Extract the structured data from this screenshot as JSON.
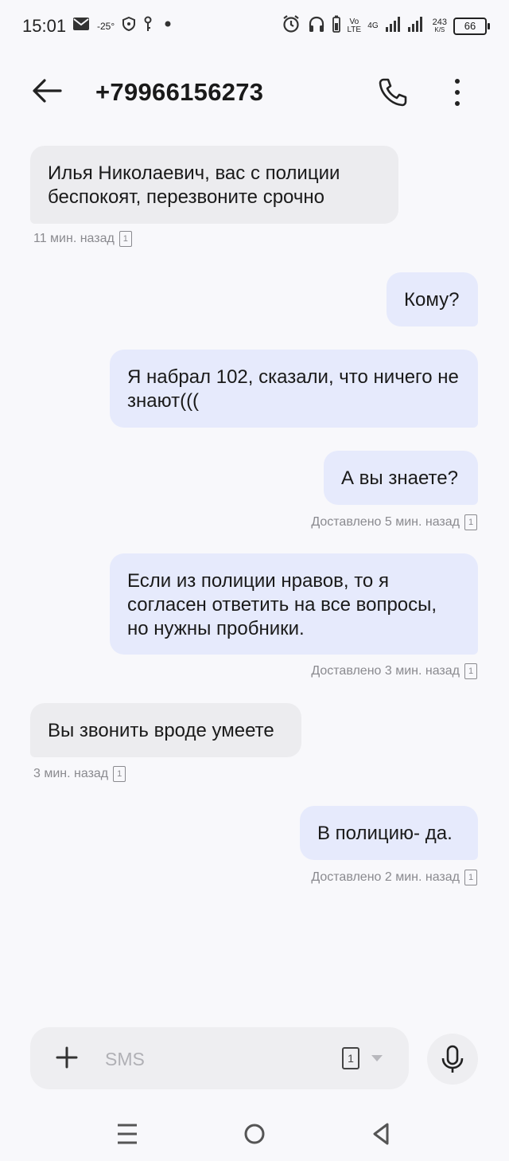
{
  "status_bar": {
    "time": "15:01",
    "temperature": "-25°",
    "volte": "Vo LTE",
    "network": "4G",
    "speed_value": "243",
    "speed_unit": "K/S",
    "battery": "66",
    "icons": [
      "mail-icon",
      "shield-icon",
      "key-icon",
      "dot-icon",
      "alarm-icon",
      "headphones-icon",
      "signal-icon",
      "signal-icon-2"
    ]
  },
  "header": {
    "title": "+79966156273",
    "icons": [
      "back-arrow-icon",
      "phone-icon",
      "more-vertical-icon"
    ]
  },
  "messages": [
    {
      "direction": "in",
      "text": "Илья Николаевич, вас с полиции беспокоят, перезвоните срочно",
      "meta": "11 мин. назад",
      "sim": "1"
    },
    {
      "direction": "out",
      "text": "Кому?",
      "meta": "",
      "sim": ""
    },
    {
      "direction": "out",
      "text": "Я набрал 102, сказали, что ничего не знают(((",
      "meta": "",
      "sim": ""
    },
    {
      "direction": "out",
      "text": "А вы знаете?",
      "meta": "Доставлено 5 мин. назад",
      "sim": "1"
    },
    {
      "direction": "out",
      "text": "Если из полиции нравов, то я согласен ответить на все вопросы, но нужны пробники.",
      "meta": "Доставлено 3 мин. назад",
      "sim": "1"
    },
    {
      "direction": "in",
      "text": "Вы звонить вроде умеете",
      "meta": "3 мин. назад",
      "sim": "1"
    },
    {
      "direction": "out",
      "text": "В полицию- да.",
      "meta": "Доставлено 2 мин. назад",
      "sim": "1"
    }
  ],
  "composer": {
    "placeholder": "SMS",
    "value": "",
    "sim": "1",
    "icons": [
      "plus-icon",
      "sim-card-icon",
      "dropdown-arrow-icon",
      "microphone-icon"
    ]
  },
  "nav": {
    "icons": [
      "menu-icon",
      "home-circle-icon",
      "back-triangle-icon"
    ]
  },
  "colors": {
    "background": "#f8f8fb",
    "incoming_bubble": "#ececef",
    "outgoing_bubble": "#e6eafc",
    "meta_text": "#8a8a8f"
  }
}
